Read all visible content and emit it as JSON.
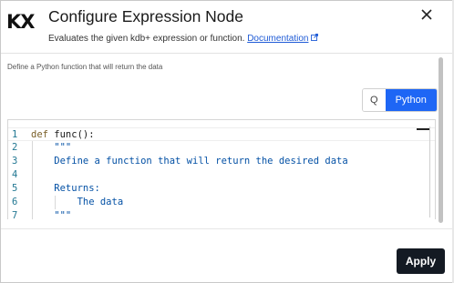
{
  "header": {
    "logo_text": "KX",
    "title": "Configure Expression Node",
    "subtitle": "Evaluates the given kdb+ expression or function.",
    "doc_link": "Documentation",
    "close_icon": "close-icon"
  },
  "main": {
    "description": "Define a Python function that will return the data",
    "language_toggle": {
      "options": [
        "Q",
        "Python"
      ],
      "selected": "Python"
    },
    "editor": {
      "line_numbers": [
        "1",
        "2",
        "3",
        "4",
        "5",
        "6",
        "7"
      ],
      "lines": [
        "def func():",
        "    \"\"\"",
        "    Define a function that will return the desired data",
        "",
        "    Returns:",
        "        The data",
        "    \"\"\""
      ],
      "line1_keyword": "def",
      "line1_rest": " func():"
    }
  },
  "footer": {
    "apply_label": "Apply"
  },
  "colors": {
    "accent": "#1e66f5",
    "apply_bg": "#141a23",
    "link": "#1f5bd6"
  }
}
